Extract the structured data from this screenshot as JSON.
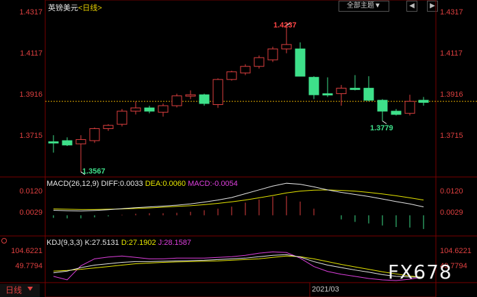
{
  "header": {
    "instrument": "英镑美元",
    "period_tag": "<日线>",
    "subject_button": "全部主题",
    "subject_arrow": "▼",
    "nav_prev": "◀",
    "nav_next": "▶"
  },
  "price_axis": {
    "left": [
      "1.4317",
      "1.4117",
      "1.3916",
      "1.3715"
    ],
    "right": [
      "1.4317",
      "1.4117",
      "1.3916",
      "1.3715"
    ]
  },
  "annotations": {
    "high": "1.4237",
    "low": "1.3567",
    "recent_low": "1.3779"
  },
  "macd": {
    "label": "MACD(26,12,9)",
    "diff": "DIFF:0.0033",
    "dea": "DEA:0.0060",
    "macd": "MACD:-0.0054",
    "axis_left": [
      "0.0120",
      "0.0029"
    ],
    "axis_right": [
      "0.0120",
      "0.0029"
    ]
  },
  "kdj": {
    "label": "KDJ(9,3,3)",
    "k": "K:27.5131",
    "d": "D:27.1902",
    "j": "J:28.1587",
    "axis_left": [
      "104.6221",
      "49.7794"
    ],
    "axis_right": [
      "104.6221",
      "49.7794"
    ]
  },
  "footer": {
    "period": "日线",
    "date": "2021/03"
  },
  "watermark": "FX678",
  "colors": {
    "up": "#e04040",
    "down": "#3ee08a",
    "diff_line": "#e8e8e8",
    "dea_line": "#e8e800",
    "j_line": "#e040e0"
  },
  "chart_data": {
    "type": "candlestick",
    "ylim": [
      1.355,
      1.4335
    ],
    "reference_price": 1.389,
    "candles": [
      {
        "o": 1.3705,
        "h": 1.3735,
        "l": 1.3655,
        "c": 1.3705,
        "dir": "down"
      },
      {
        "o": 1.371,
        "h": 1.3725,
        "l": 1.3685,
        "c": 1.369,
        "dir": "down"
      },
      {
        "o": 1.3695,
        "h": 1.3735,
        "l": 1.3567,
        "c": 1.3715,
        "dir": "up"
      },
      {
        "o": 1.371,
        "h": 1.377,
        "l": 1.37,
        "c": 1.3765,
        "dir": "up"
      },
      {
        "o": 1.3765,
        "h": 1.3785,
        "l": 1.3755,
        "c": 1.378,
        "dir": "up"
      },
      {
        "o": 1.3785,
        "h": 1.3855,
        "l": 1.3775,
        "c": 1.3845,
        "dir": "up"
      },
      {
        "o": 1.3845,
        "h": 1.389,
        "l": 1.383,
        "c": 1.386,
        "dir": "up"
      },
      {
        "o": 1.386,
        "h": 1.387,
        "l": 1.3835,
        "c": 1.3845,
        "dir": "down"
      },
      {
        "o": 1.384,
        "h": 1.388,
        "l": 1.382,
        "c": 1.387,
        "dir": "up"
      },
      {
        "o": 1.387,
        "h": 1.3925,
        "l": 1.3862,
        "c": 1.3915,
        "dir": "up"
      },
      {
        "o": 1.3915,
        "h": 1.394,
        "l": 1.39,
        "c": 1.392,
        "dir": "up"
      },
      {
        "o": 1.392,
        "h": 1.3925,
        "l": 1.387,
        "c": 1.388,
        "dir": "down"
      },
      {
        "o": 1.3875,
        "h": 1.3995,
        "l": 1.386,
        "c": 1.399,
        "dir": "up"
      },
      {
        "o": 1.399,
        "h": 1.403,
        "l": 1.3985,
        "c": 1.4025,
        "dir": "up"
      },
      {
        "o": 1.402,
        "h": 1.406,
        "l": 1.401,
        "c": 1.405,
        "dir": "up"
      },
      {
        "o": 1.405,
        "h": 1.41,
        "l": 1.404,
        "c": 1.409,
        "dir": "up"
      },
      {
        "o": 1.408,
        "h": 1.414,
        "l": 1.407,
        "c": 1.413,
        "dir": "up"
      },
      {
        "o": 1.413,
        "h": 1.4237,
        "l": 1.411,
        "c": 1.415,
        "dir": "up"
      },
      {
        "o": 1.413,
        "h": 1.416,
        "l": 1.4005,
        "c": 1.4005,
        "dir": "down"
      },
      {
        "o": 1.4,
        "h": 1.4005,
        "l": 1.39,
        "c": 1.392,
        "dir": "down"
      },
      {
        "o": 1.3925,
        "h": 1.4,
        "l": 1.391,
        "c": 1.3925,
        "dir": "down"
      },
      {
        "o": 1.3925,
        "h": 1.3965,
        "l": 1.387,
        "c": 1.395,
        "dir": "up"
      },
      {
        "o": 1.395,
        "h": 1.401,
        "l": 1.394,
        "c": 1.3945,
        "dir": "down"
      },
      {
        "o": 1.395,
        "h": 1.4005,
        "l": 1.389,
        "c": 1.3895,
        "dir": "down"
      },
      {
        "o": 1.3895,
        "h": 1.39,
        "l": 1.38,
        "c": 1.3845,
        "dir": "down"
      },
      {
        "o": 1.3845,
        "h": 1.3855,
        "l": 1.3825,
        "c": 1.383,
        "dir": "down"
      },
      {
        "o": 1.3835,
        "h": 1.392,
        "l": 1.3825,
        "c": 1.389,
        "dir": "up"
      },
      {
        "o": 1.3895,
        "h": 1.391,
        "l": 1.387,
        "c": 1.3885,
        "dir": "down"
      }
    ],
    "macd_diff": [
      0.002,
      0.0018,
      0.0017,
      0.0019,
      0.0022,
      0.0026,
      0.003,
      0.0033,
      0.0036,
      0.004,
      0.0045,
      0.0052,
      0.006,
      0.007,
      0.0085,
      0.01,
      0.0115,
      0.0126,
      0.0122,
      0.0112,
      0.01,
      0.009,
      0.0082,
      0.0074,
      0.0064,
      0.0054,
      0.0045,
      0.0033
    ],
    "macd_dea": [
      0.0025,
      0.0024,
      0.0023,
      0.0023,
      0.0024,
      0.0025,
      0.0027,
      0.0029,
      0.0032,
      0.0035,
      0.0038,
      0.0042,
      0.0047,
      0.0053,
      0.006,
      0.0069,
      0.0078,
      0.0088,
      0.0095,
      0.0099,
      0.01,
      0.0098,
      0.0095,
      0.009,
      0.0084,
      0.0077,
      0.0069,
      0.006
    ],
    "macd_hist": [
      -0.001,
      -0.0012,
      -0.0012,
      -0.0008,
      -0.0004,
      0.0002,
      0.0006,
      0.0008,
      0.0008,
      0.001,
      0.0014,
      0.002,
      0.0026,
      0.0034,
      0.005,
      0.0062,
      0.0074,
      0.0076,
      0.0054,
      0.0026,
      0.0,
      -0.0016,
      -0.0026,
      -0.0032,
      -0.004,
      -0.0046,
      -0.0048,
      -0.0054
    ],
    "kdj_k": [
      40,
      45,
      55,
      62,
      66,
      70,
      72,
      72,
      73,
      74,
      75,
      76,
      78,
      80,
      82,
      86,
      90,
      92,
      85,
      72,
      62,
      55,
      48,
      42,
      35,
      30,
      28,
      27.5
    ],
    "kdj_d": [
      45,
      47,
      50,
      54,
      58,
      62,
      66,
      68,
      70,
      71,
      72,
      73,
      74,
      76,
      78,
      80,
      84,
      88,
      86,
      80,
      72,
      64,
      57,
      50,
      43,
      37,
      31,
      27.2
    ],
    "kdj_j": [
      30,
      20,
      60,
      80,
      85,
      88,
      84,
      80,
      80,
      82,
      82,
      82,
      84,
      86,
      90,
      96,
      100,
      98,
      82,
      58,
      44,
      36,
      30,
      24,
      20,
      18,
      22,
      28.2
    ],
    "kdj_range": [
      20,
      110
    ]
  }
}
